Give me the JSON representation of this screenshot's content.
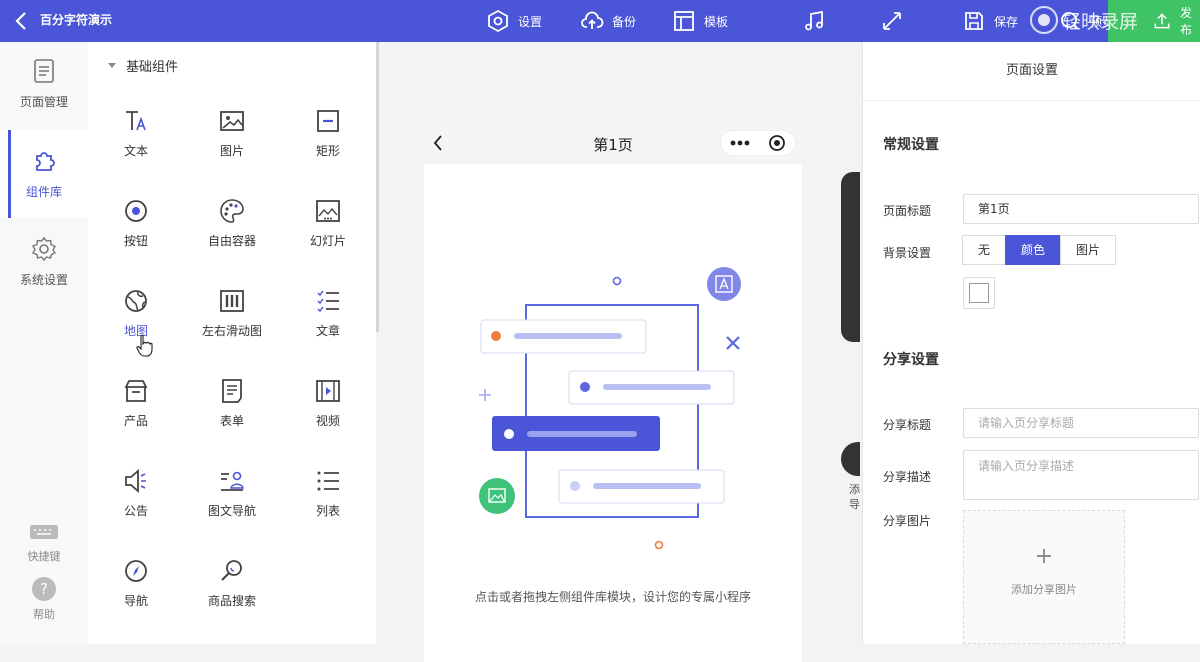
{
  "topbar": {
    "title": "百分字符演示",
    "items": [
      {
        "label": "设置",
        "icon": "settings-icon"
      },
      {
        "label": "备份",
        "icon": "cloud-upload-icon"
      },
      {
        "label": "模板",
        "icon": "template-icon"
      },
      {
        "label": "",
        "icon": "music-icon"
      },
      {
        "label": "",
        "icon": "fullscreen-icon"
      },
      {
        "label": "保存",
        "icon": "save-icon"
      },
      {
        "label": "预览",
        "icon": "preview-icon"
      },
      {
        "label": "发布",
        "icon": "publish-icon"
      }
    ],
    "watermark": "轻映录屏"
  },
  "leftnav": {
    "items": [
      {
        "label": "页面管理",
        "icon": "page-manage-icon"
      },
      {
        "label": "组件库",
        "icon": "puzzle-icon"
      },
      {
        "label": "系统设置",
        "icon": "gear-icon"
      }
    ],
    "bottom": [
      {
        "label": "快捷键",
        "icon": "keyboard-icon"
      },
      {
        "label": "帮助",
        "icon": "help-icon"
      }
    ],
    "accent": "#4a55d8"
  },
  "library": {
    "section": "基础组件",
    "components": [
      {
        "label": "文本",
        "icon": "text-icon"
      },
      {
        "label": "图片",
        "icon": "image-icon"
      },
      {
        "label": "矩形",
        "icon": "rectangle-icon"
      },
      {
        "label": "按钮",
        "icon": "button-icon"
      },
      {
        "label": "自由容器",
        "icon": "palette-icon"
      },
      {
        "label": "幻灯片",
        "icon": "slideshow-icon"
      },
      {
        "label": "地图",
        "icon": "map-icon"
      },
      {
        "label": "左右滑动图",
        "icon": "swipe-gallery-icon"
      },
      {
        "label": "文章",
        "icon": "article-icon"
      },
      {
        "label": "产品",
        "icon": "product-icon"
      },
      {
        "label": "表单",
        "icon": "form-icon"
      },
      {
        "label": "视频",
        "icon": "video-icon"
      },
      {
        "label": "公告",
        "icon": "announcement-icon"
      },
      {
        "label": "图文导航",
        "icon": "image-text-nav-icon"
      },
      {
        "label": "列表",
        "icon": "list-icon"
      },
      {
        "label": "导航",
        "icon": "compass-icon"
      },
      {
        "label": "商品搜索",
        "icon": "product-search-icon"
      }
    ]
  },
  "canvas": {
    "page_title": "第1页",
    "hint": "点击或者拖拽左侧组件库模块，设计您的专属小程序",
    "side_label": "添导"
  },
  "rpanel": {
    "header": "页面设置",
    "general": {
      "title": "常规设置",
      "page_title_label": "页面标题",
      "page_title_value": "第1页",
      "bg_label": "背景设置",
      "bg_options": [
        "无",
        "颜色",
        "图片"
      ],
      "bg_selected": "颜色"
    },
    "share": {
      "title": "分享设置",
      "title_label": "分享标题",
      "title_placeholder": "请输入页分享标题",
      "desc_label": "分享描述",
      "desc_placeholder": "请输入页分享描述",
      "image_label": "分享图片",
      "add_image": "添加分享图片"
    }
  }
}
